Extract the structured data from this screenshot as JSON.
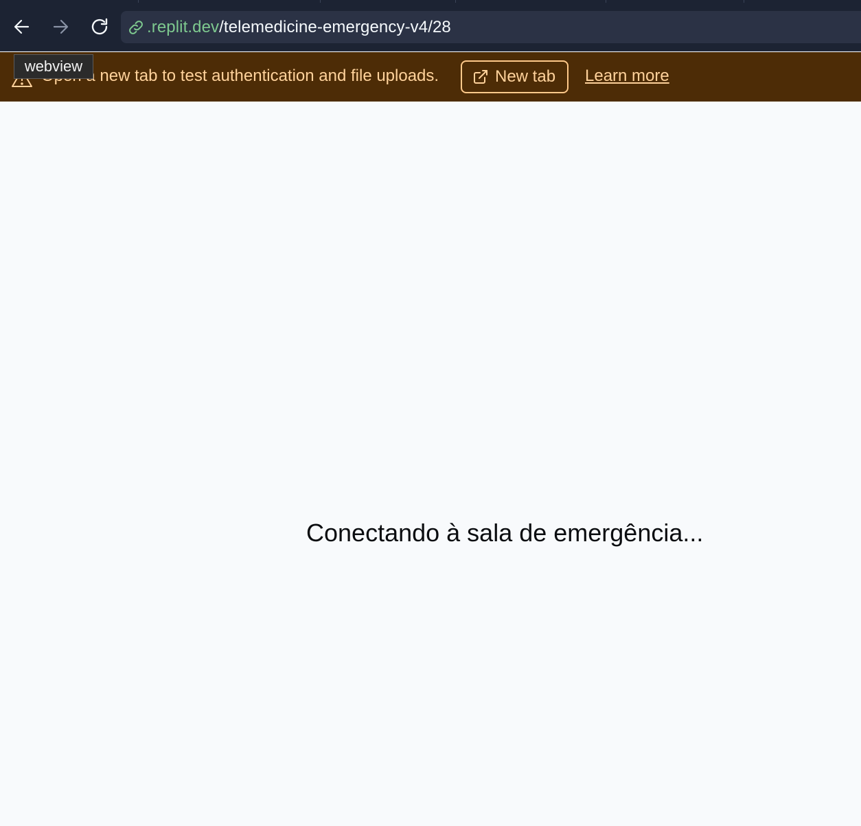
{
  "browser": {
    "url_domain": ".replit.dev",
    "url_path": "/telemedicine-emergency-v4/28",
    "back_icon": "arrow-left-icon",
    "forward_icon": "arrow-right-icon",
    "reload_icon": "reload-icon",
    "link_icon": "link-icon"
  },
  "banner": {
    "message": "Open a new tab to test authentication and file uploads.",
    "new_tab_label": "New tab",
    "learn_more_label": "Learn more",
    "warning_icon": "warning-triangle-icon",
    "external_icon": "external-link-icon",
    "background_color": "#4d2c06",
    "text_color": "#ffd29b"
  },
  "tooltip": {
    "text": "webview"
  },
  "page": {
    "loading_message": "Conectando à sala de emergência..."
  }
}
